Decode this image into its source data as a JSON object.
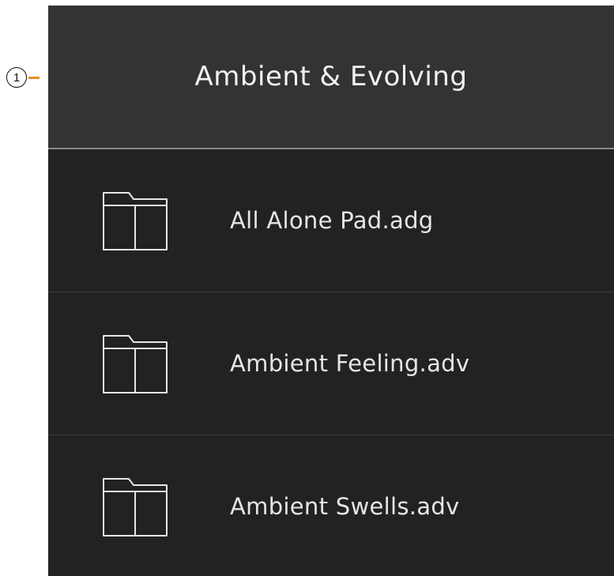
{
  "callout": {
    "number": "1"
  },
  "header": {
    "title": "Ambient & Evolving"
  },
  "items": [
    {
      "label": "All Alone Pad.adg",
      "icon": "folder-icon"
    },
    {
      "label": "Ambient Feeling.adv",
      "icon": "folder-icon"
    },
    {
      "label": "Ambient Swells.adv",
      "icon": "folder-icon"
    }
  ],
  "colors": {
    "panel_bg": "#222222",
    "header_bg": "#333333",
    "text": "#e6e6e6",
    "accent": "#f08a24"
  }
}
